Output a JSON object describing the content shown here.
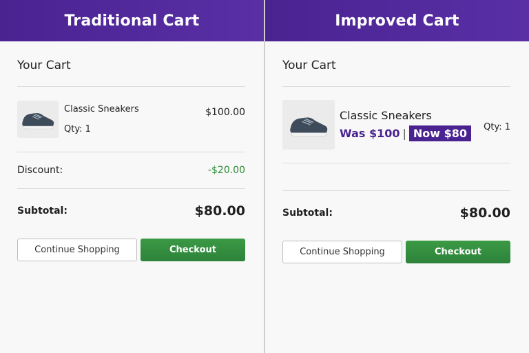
{
  "left": {
    "header": "Traditional Cart",
    "cart_title": "Your Cart",
    "item": {
      "name": "Classic Sneakers",
      "qty": "Qty: 1",
      "price": "$100.00"
    },
    "discount_label": "Discount:",
    "discount_value": "-$20.00",
    "subtotal_label": "Subtotal:",
    "subtotal_value": "$80.00",
    "continue_label": "Continue Shopping",
    "checkout_label": "Checkout"
  },
  "right": {
    "header": "Improved Cart",
    "cart_title": "Your Cart",
    "item": {
      "name": "Classic Sneakers",
      "was": "Was $100",
      "separator": "|",
      "now": "Now $80",
      "qty": "Qty: 1"
    },
    "subtotal_label": "Subtotal:",
    "subtotal_value": "$80.00",
    "continue_label": "Continue Shopping",
    "checkout_label": "Checkout"
  },
  "colors": {
    "header": "#4a2391",
    "checkout": "#2e8b3a",
    "discount": "#2e8b3a",
    "price_highlight": "#4a2391"
  },
  "icons": {
    "product": "sneaker-icon"
  }
}
